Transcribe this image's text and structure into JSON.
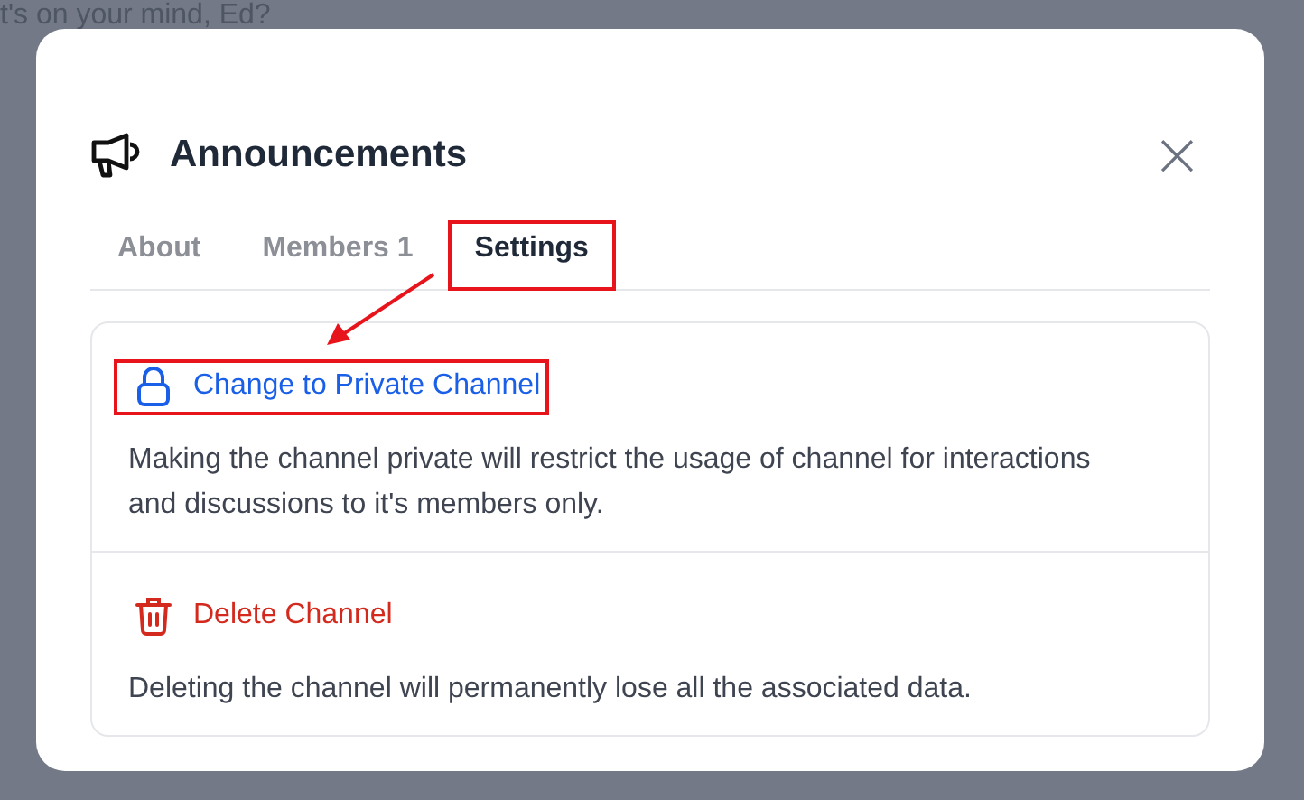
{
  "backdrop": {
    "prompt": "t's on your mind, Ed?"
  },
  "dialog": {
    "title": "Announcements",
    "close": "×"
  },
  "tabs": [
    {
      "label": "About",
      "selected": false,
      "highlighted": false
    },
    {
      "label": "Members 1",
      "selected": false,
      "highlighted": false
    },
    {
      "label": "Settings",
      "selected": true,
      "highlighted": true
    }
  ],
  "options": [
    {
      "kind": "private",
      "title": "Change to Private Channel",
      "highlighted": true,
      "description": "Making the channel private will restrict the usage of channel for interactions and discussions to it's members only."
    },
    {
      "kind": "delete",
      "title": "Delete Channel",
      "highlighted": false,
      "description": "Deleting the channel will permanently lose all the associated data."
    }
  ],
  "annotation_arrow": true
}
